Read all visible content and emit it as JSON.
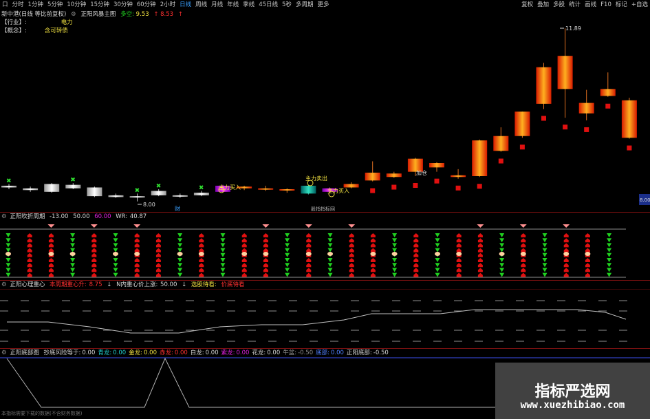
{
  "toolbar": {
    "left_items": [
      "口",
      "分时",
      "1分钟",
      "5分钟",
      "10分钟",
      "15分钟",
      "30分钟",
      "60分钟",
      "2小时",
      "日线",
      "周线",
      "月线",
      "年线",
      "季线",
      "45日线",
      "5秒",
      "多周期",
      "更多"
    ],
    "active": "日线",
    "right_items": [
      "复权",
      "叠加",
      "多股",
      "统计",
      "画线",
      "F10",
      "标记",
      "+自选"
    ]
  },
  "main_panel": {
    "stock_label": "新中港(日线 等比前复权)",
    "indicator_name": "正阳风暴主图",
    "duokong_label": "多空:",
    "duokong_value": "9.53",
    "value2": "8.53",
    "industry_label": "【行业】:",
    "industry_value": "电力",
    "concept_label": "【概念】:",
    "concept_value": "含可转债",
    "high_price": "11.89",
    "low_price": "8.00",
    "right_price": "8.00",
    "annotations": {
      "zhuli_mairu1": "主力买入",
      "zhuli_maichu": "主力卖出",
      "zhuli_mairu2": "主力买入",
      "jiacang": "加仓",
      "cai": "财",
      "center_watermark": "股指指标网"
    }
  },
  "panel2": {
    "name": "正阳吹折周期",
    "v1": "-13.00",
    "v2": "50.00",
    "v3": "60.00",
    "wr_label": "WR:",
    "wr_value": "40.87"
  },
  "panel3": {
    "name": "正阳心理重心",
    "label1": "本周期重心升:",
    "value1": "8.75",
    "label2": "N内重心价上涨:",
    "value2": "50.00",
    "label3": "选股待看:",
    "label4": "价底待看"
  },
  "panel4": {
    "name": "正阳底部图",
    "items": [
      {
        "label": "抄底风险等于:",
        "value": "0.00",
        "color": "#d8d8d8"
      },
      {
        "label": "青龙:",
        "value": "0.00",
        "color": "#20d0d0"
      },
      {
        "label": "金龙:",
        "value": "0.00",
        "color": "#f0e040"
      },
      {
        "label": "赤龙:",
        "value": "0.00",
        "color": "#ff3030"
      },
      {
        "label": "白龙:",
        "value": "0.00",
        "color": "#d8d8d8"
      },
      {
        "label": "紫龙:",
        "value": "0.00",
        "color": "#e020e0"
      },
      {
        "label": "花龙:",
        "value": "0.00",
        "color": "#d8d8d8"
      },
      {
        "label": "牛盆:",
        "value": "-0.50",
        "color": "#909090"
      },
      {
        "label": "底部:",
        "value": "0.00",
        "color": "#5080ff"
      },
      {
        "label": "正阳底部:",
        "value": "-0.50",
        "color": "#d8d8d8"
      }
    ],
    "footer_note": "本指标需要下载的数据(不含财务数据)"
  },
  "watermark": {
    "line1": "指标严选网",
    "line2": "www.xuezhibiao.com"
  },
  "chart_data": {
    "type": "candlestick",
    "candles": [
      {
        "o": 8.28,
        "c": 8.24,
        "h": 8.32,
        "l": 8.2,
        "kind": "flat"
      },
      {
        "o": 8.22,
        "c": 8.18,
        "h": 8.26,
        "l": 8.14,
        "kind": "white"
      },
      {
        "o": 8.32,
        "c": 8.14,
        "h": 8.34,
        "l": 8.12,
        "kind": "white"
      },
      {
        "o": 8.3,
        "c": 8.22,
        "h": 8.34,
        "l": 8.2,
        "kind": "white"
      },
      {
        "o": 8.24,
        "c": 8.04,
        "h": 8.26,
        "l": 8.02,
        "kind": "white"
      },
      {
        "o": 8.06,
        "c": 8.02,
        "h": 8.1,
        "l": 8.0,
        "kind": "white"
      },
      {
        "o": 8.02,
        "c": 8.04,
        "h": 8.1,
        "l": 7.92,
        "kind": "flat"
      },
      {
        "o": 8.16,
        "c": 8.06,
        "h": 8.2,
        "l": 8.04,
        "kind": "white"
      },
      {
        "o": 8.06,
        "c": 8.04,
        "h": 8.1,
        "l": 8.0,
        "kind": "white"
      },
      {
        "o": 8.12,
        "c": 8.06,
        "h": 8.16,
        "l": 8.04,
        "kind": "white"
      },
      {
        "o": 8.14,
        "c": 8.28,
        "h": 8.3,
        "l": 8.12,
        "kind": "magenta"
      },
      {
        "o": 8.22,
        "c": 8.26,
        "h": 8.28,
        "l": 8.18,
        "kind": "red"
      },
      {
        "o": 8.2,
        "c": 8.22,
        "h": 8.28,
        "l": 8.16,
        "kind": "red"
      },
      {
        "o": 8.18,
        "c": 8.2,
        "h": 8.22,
        "l": 8.12,
        "kind": "red"
      },
      {
        "o": 8.1,
        "c": 8.28,
        "h": 8.3,
        "l": 8.08,
        "kind": "teal"
      },
      {
        "o": 8.14,
        "c": 8.22,
        "h": 8.24,
        "l": 8.12,
        "kind": "magenta"
      },
      {
        "o": 8.24,
        "c": 8.32,
        "h": 8.36,
        "l": 8.22,
        "kind": "red"
      },
      {
        "o": 8.4,
        "c": 8.58,
        "h": 8.84,
        "l": 8.38,
        "kind": "red"
      },
      {
        "o": 8.48,
        "c": 8.56,
        "h": 8.6,
        "l": 8.46,
        "kind": "red"
      },
      {
        "o": 8.6,
        "c": 8.9,
        "h": 8.92,
        "l": 8.5,
        "kind": "red"
      },
      {
        "o": 8.7,
        "c": 8.8,
        "h": 8.82,
        "l": 8.6,
        "kind": "red"
      },
      {
        "o": 8.48,
        "c": 8.52,
        "h": 8.66,
        "l": 8.44,
        "kind": "red"
      },
      {
        "o": 8.5,
        "c": 9.32,
        "h": 9.34,
        "l": 8.48,
        "kind": "red"
      },
      {
        "o": 9.08,
        "c": 9.42,
        "h": 9.62,
        "l": 9.06,
        "kind": "red"
      },
      {
        "o": 9.42,
        "c": 9.98,
        "h": 9.98,
        "l": 9.38,
        "kind": "red"
      },
      {
        "o": 10.16,
        "c": 11.0,
        "h": 11.1,
        "l": 10.04,
        "kind": "red"
      },
      {
        "o": 10.5,
        "c": 11.26,
        "h": 11.89,
        "l": 9.84,
        "kind": "red"
      },
      {
        "o": 9.94,
        "c": 10.18,
        "h": 10.48,
        "l": 9.78,
        "kind": "red"
      },
      {
        "o": 10.34,
        "c": 10.5,
        "h": 10.88,
        "l": 10.32,
        "kind": "red"
      },
      {
        "o": 9.38,
        "c": 10.24,
        "h": 10.3,
        "l": 9.36,
        "kind": "red"
      }
    ],
    "ylim": [
      7.9,
      12.1
    ],
    "high_label": "11.89",
    "low_label": "8.00"
  }
}
